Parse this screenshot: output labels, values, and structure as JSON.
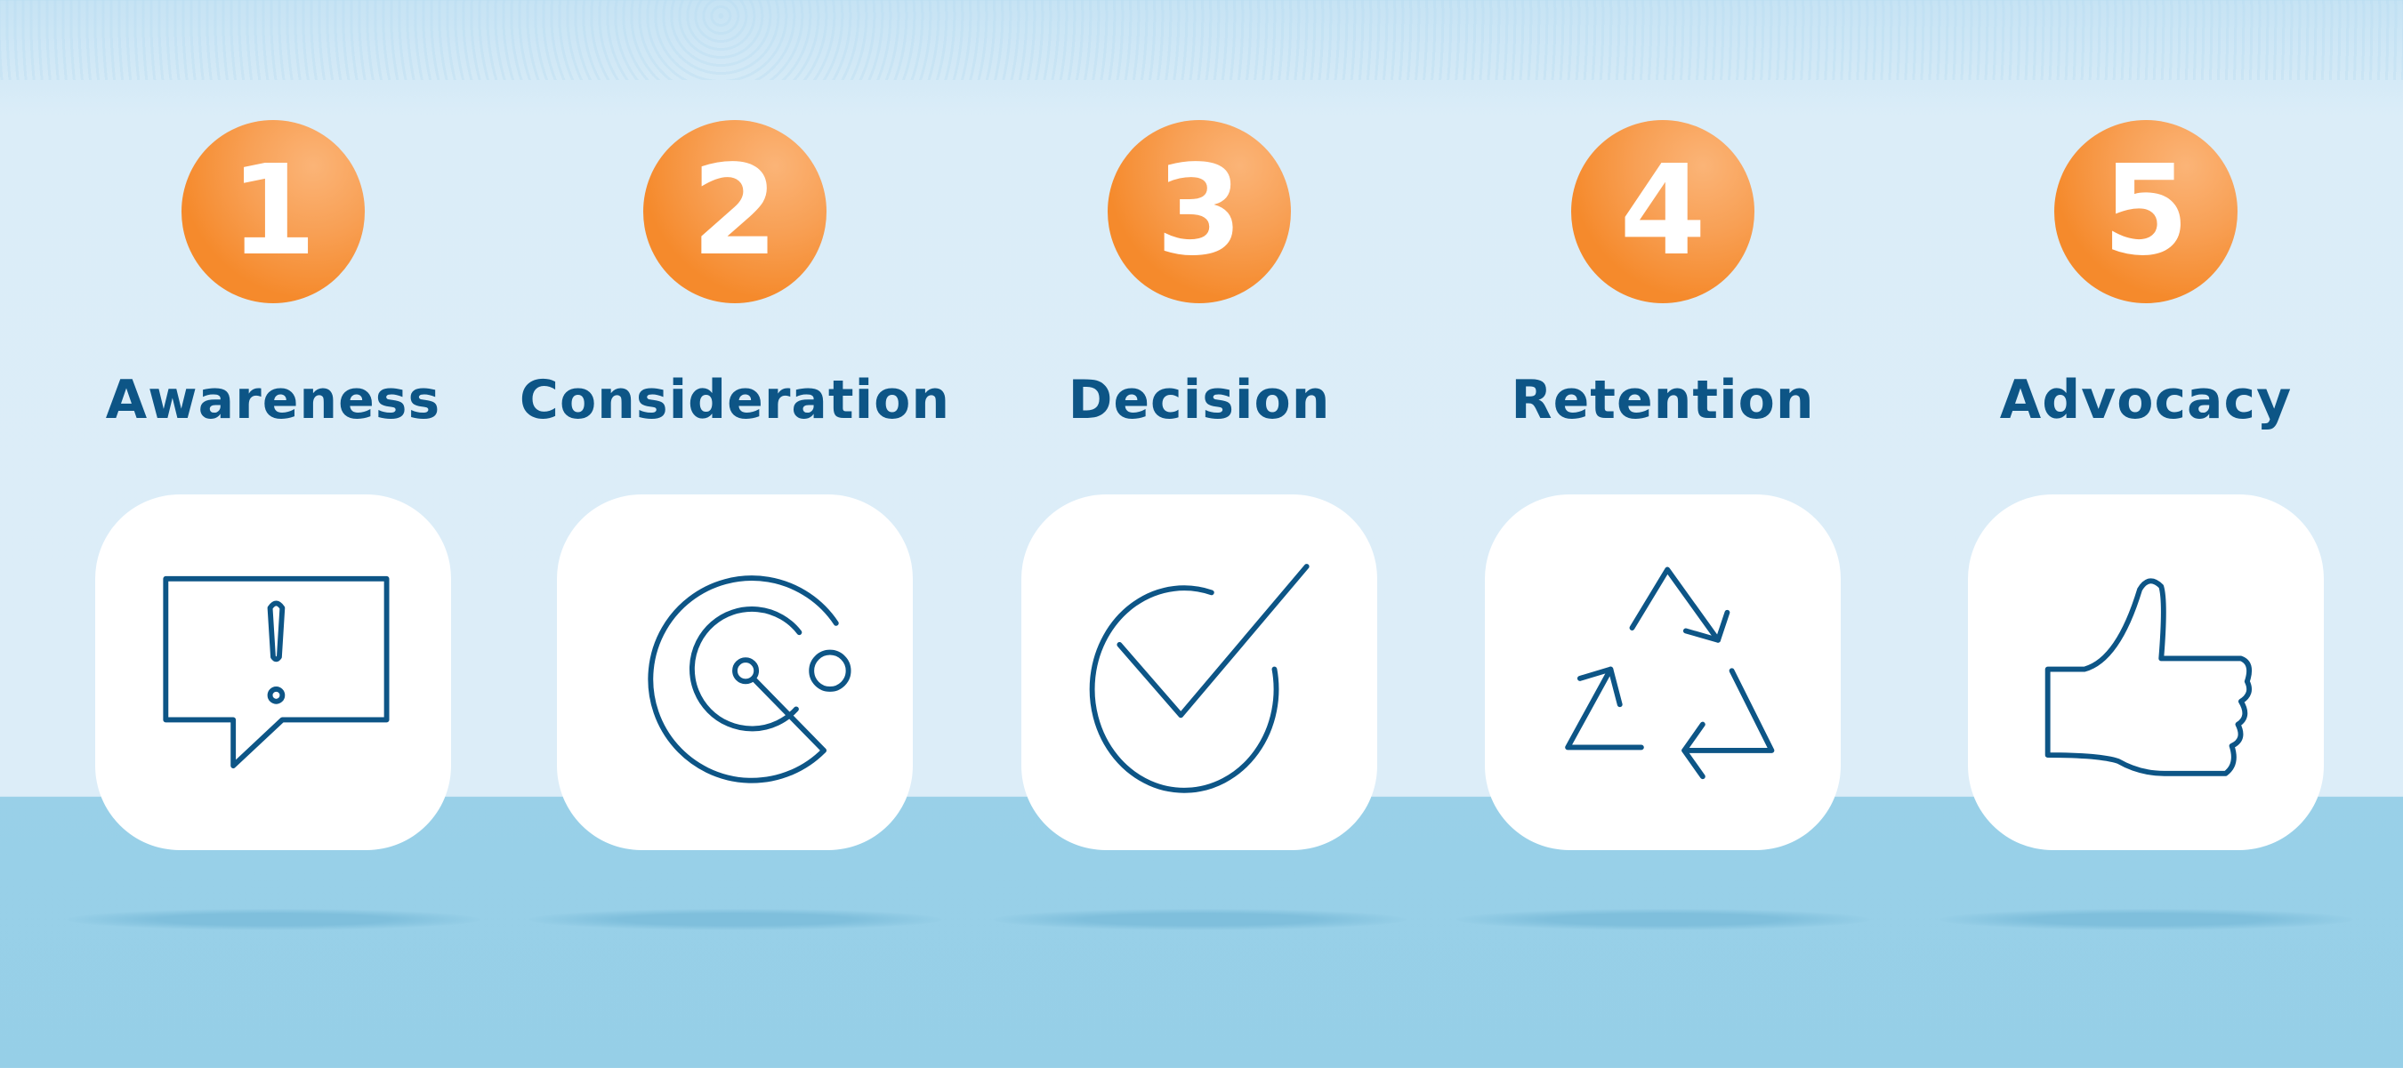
{
  "stages": [
    {
      "number": "1",
      "label": "Awareness",
      "icon": "speech-bubble-exclamation-icon"
    },
    {
      "number": "2",
      "label": "Consideration",
      "icon": "target-radar-icon"
    },
    {
      "number": "3",
      "label": "Decision",
      "icon": "checkmark-circle-icon"
    },
    {
      "number": "4",
      "label": "Retention",
      "icon": "recycle-icon"
    },
    {
      "number": "5",
      "label": "Advocacy",
      "icon": "thumbs-up-icon"
    }
  ],
  "colors": {
    "number_circle": "#f58a2c",
    "text": "#0d5586",
    "sky": "#dbedf8",
    "ground": "#98d0e8",
    "card": "#ffffff"
  }
}
